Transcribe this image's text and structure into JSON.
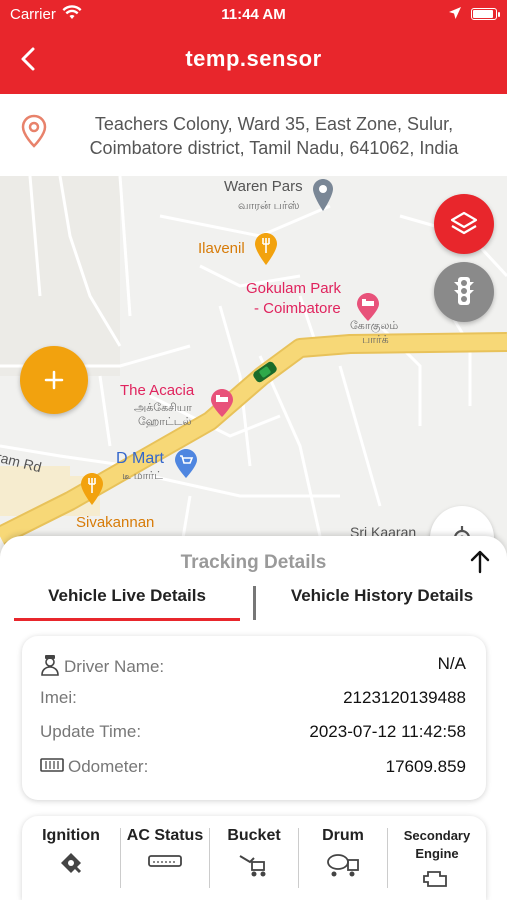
{
  "status_bar": {
    "carrier": "Carrier",
    "time": "11:44 AM"
  },
  "header": {
    "title": "temp.sensor"
  },
  "address": {
    "text": "Teachers Colony, Ward 35, East Zone, Sulur, Coimbatore district, Tamil Nadu, 641062, India"
  },
  "map": {
    "labels": {
      "waren_pars": "Waren Pars",
      "waren_pars_ta": "வாரன் பர்ஸ்",
      "ilavenil": "Ilavenil",
      "gokulam_1": "Gokulam Park",
      "gokulam_2": "- Coimbatore",
      "gokulam_ta1": "கோகுலம்",
      "gokulam_ta2": "பார்க்",
      "acacia": "The Acacia",
      "acacia_ta1": "அக்கேசியா",
      "acacia_ta2": "ஹோட்டல்",
      "dmart": "D Mart",
      "dmart_ta": "டீ மார்ட்",
      "ram_rd": "ram Rd",
      "sivakannan": "Sivakannan",
      "sri_kaaran": "Sri Kaaran"
    }
  },
  "sheet": {
    "title": "Tracking Details",
    "tabs": {
      "live": "Vehicle Live Details",
      "history": "Vehicle History Details"
    },
    "details": {
      "driver_label": "Driver Name:",
      "driver_value": "N/A",
      "imei_label": "Imei:",
      "imei_value": "2123120139488",
      "update_label": "Update Time:",
      "update_value": "2023-07-12 11:42:58",
      "odometer_label": "Odometer:",
      "odometer_value": "17609.859"
    },
    "statuses": {
      "ignition": "Ignition",
      "ac": "AC Status",
      "bucket": "Bucket",
      "drum": "Drum",
      "secondary_1": "Secondary",
      "secondary_2": "Engine"
    }
  },
  "colors": {
    "primary": "#e8262c",
    "accent": "#f2a20e",
    "road": "#f5d36b"
  }
}
